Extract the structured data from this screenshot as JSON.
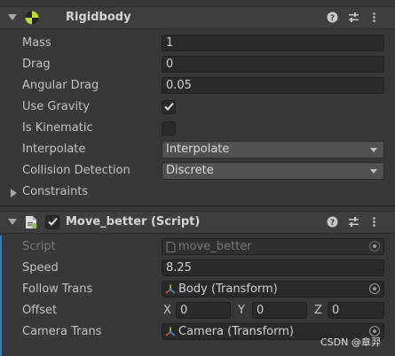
{
  "rigidbody": {
    "title": "Rigidbody",
    "fields": {
      "mass_label": "Mass",
      "mass_value": "1",
      "drag_label": "Drag",
      "drag_value": "0",
      "angular_drag_label": "Angular Drag",
      "angular_drag_value": "0.05",
      "use_gravity_label": "Use Gravity",
      "use_gravity_checked": true,
      "is_kinematic_label": "Is Kinematic",
      "is_kinematic_checked": false,
      "interpolate_label": "Interpolate",
      "interpolate_value": "Interpolate",
      "collision_label": "Collision Detection",
      "collision_value": "Discrete",
      "constraints_label": "Constraints"
    }
  },
  "script_component": {
    "title": "Move_better (Script)",
    "enabled": true,
    "fields": {
      "script_label": "Script",
      "script_value": "move_better",
      "speed_label": "Speed",
      "speed_value": "8.25",
      "follow_label": "Follow Trans",
      "follow_value": "Body (Transform)",
      "offset_label": "Offset",
      "offset_x_label": "X",
      "offset_x": "0",
      "offset_y_label": "Y",
      "offset_y": "0",
      "offset_z_label": "Z",
      "offset_z": "0",
      "camera_label": "Camera Trans",
      "camera_value": "Camera (Transform)"
    }
  },
  "watermark": "CSDN @章羿",
  "icons": [
    "foldout-arrow-icon",
    "rigidbody-icon",
    "help-icon",
    "preset-icon",
    "more-menu-icon",
    "script-icon",
    "checkbox-check-icon",
    "object-picker-icon",
    "transform-icon"
  ]
}
